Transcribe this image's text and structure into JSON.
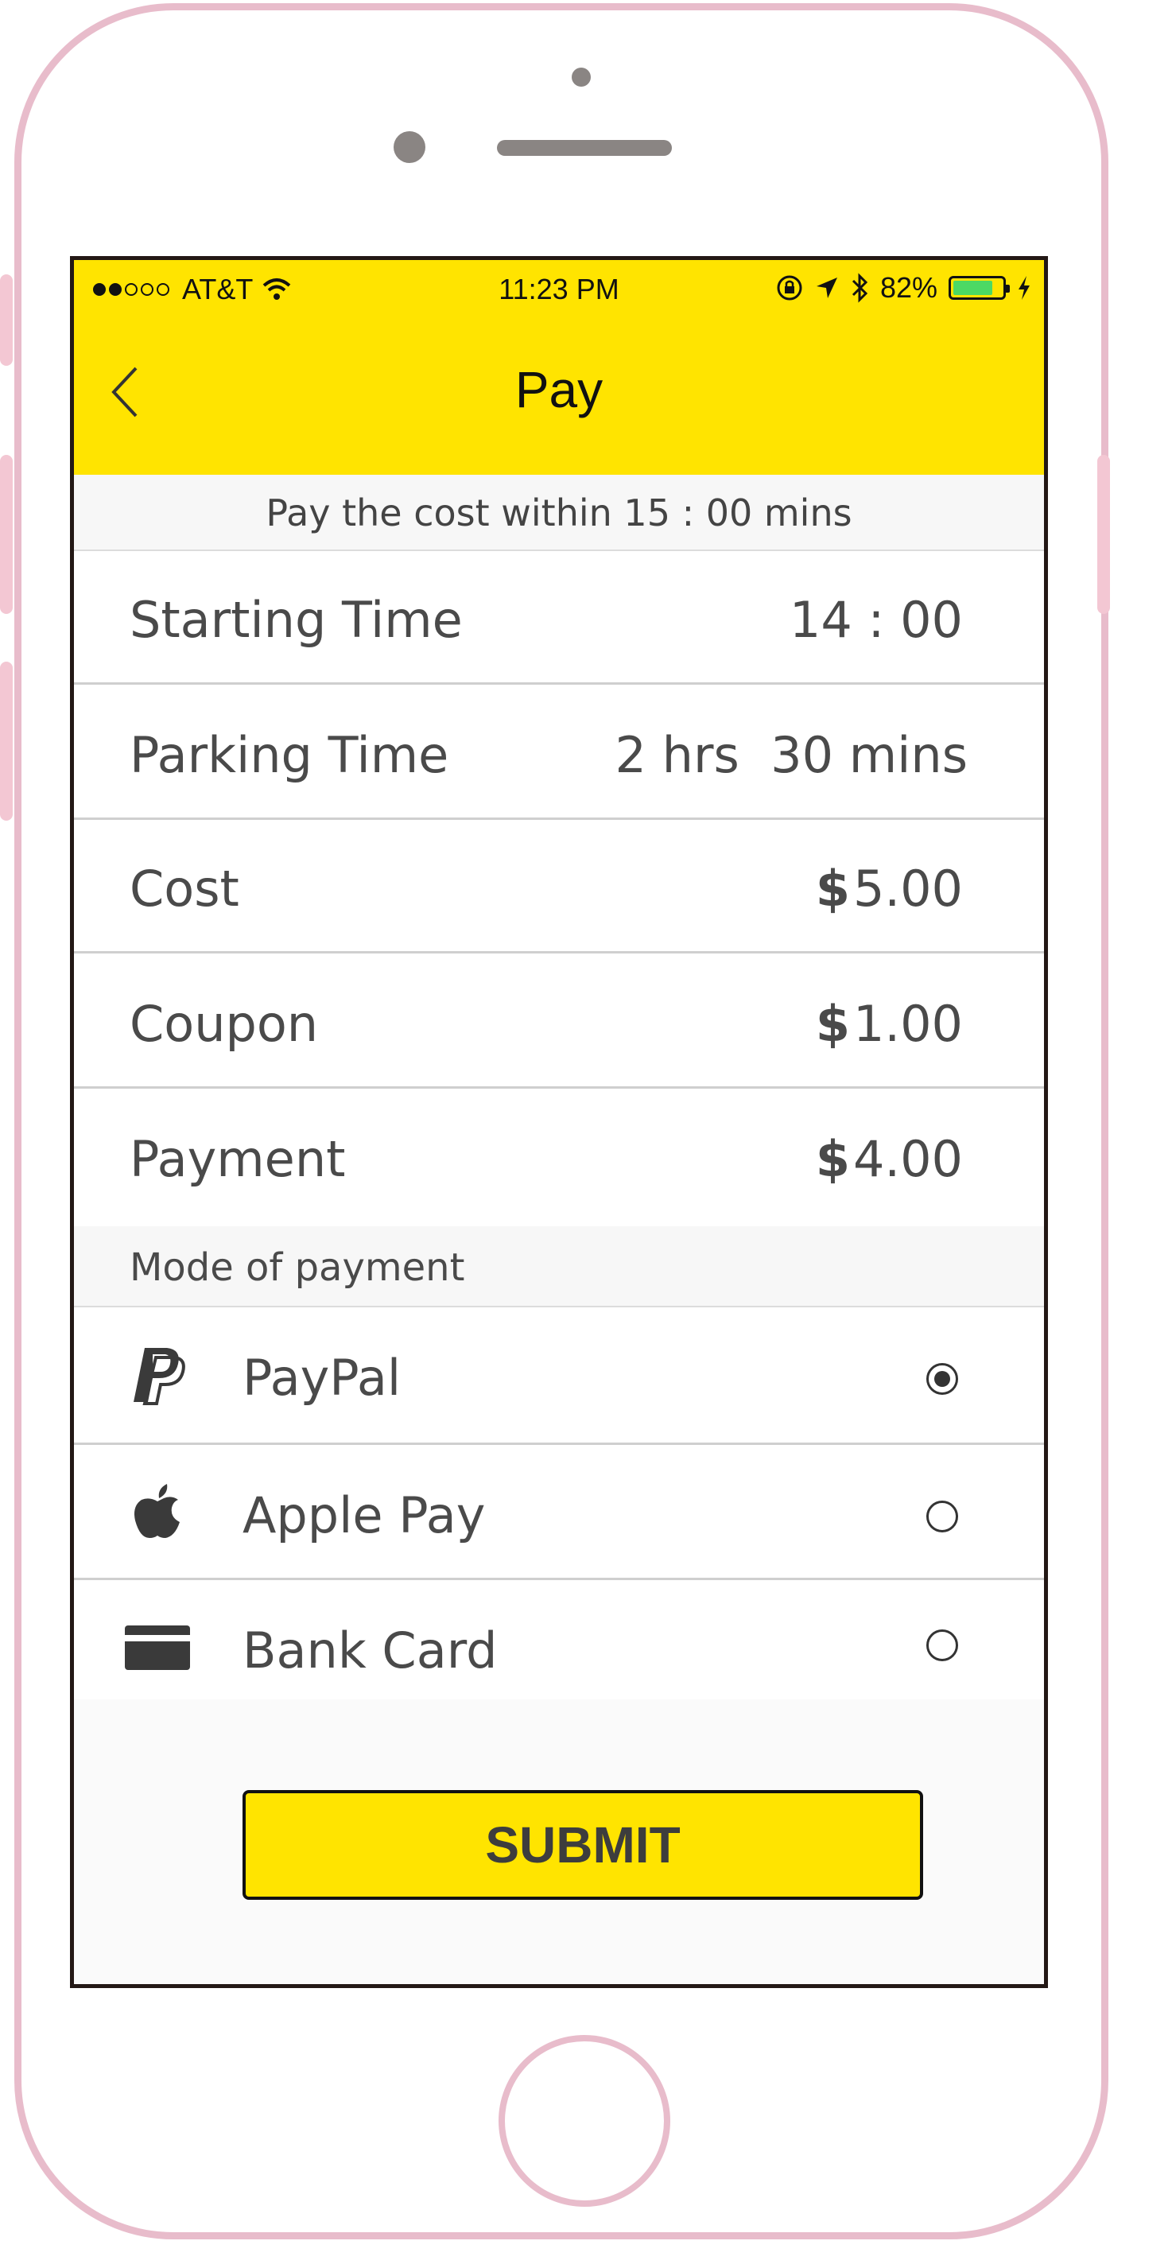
{
  "status": {
    "carrier": "AT&T",
    "time": "11:23 PM",
    "battery": "82%",
    "battery_level": 0.82
  },
  "nav": {
    "title": "Pay"
  },
  "notice": "Pay the cost within 15 : 00 mins",
  "details": [
    {
      "label": "Starting Time",
      "value": "14 : 00"
    },
    {
      "label": "Parking Time",
      "value": "2 hrs  30 mins"
    },
    {
      "label": "Cost",
      "currency": "$",
      "value": "5.00"
    },
    {
      "label": "Coupon",
      "currency": "$",
      "value": "1.00"
    },
    {
      "label": "Payment",
      "currency": "$",
      "value": "4.00"
    }
  ],
  "payment_section": {
    "title": "Mode of payment",
    "methods": [
      {
        "label": "PayPal",
        "icon": "paypal-icon",
        "selected": true
      },
      {
        "label": "Apple Pay",
        "icon": "apple-icon",
        "selected": false
      },
      {
        "label": "Bank Card",
        "icon": "bank-card-icon",
        "selected": false
      }
    ]
  },
  "submit_label": "SUBMIT",
  "colors": {
    "accent": "#ffe400",
    "text": "#4a4a4a",
    "frame": "#e8bccb",
    "battery": "#4cd964"
  }
}
